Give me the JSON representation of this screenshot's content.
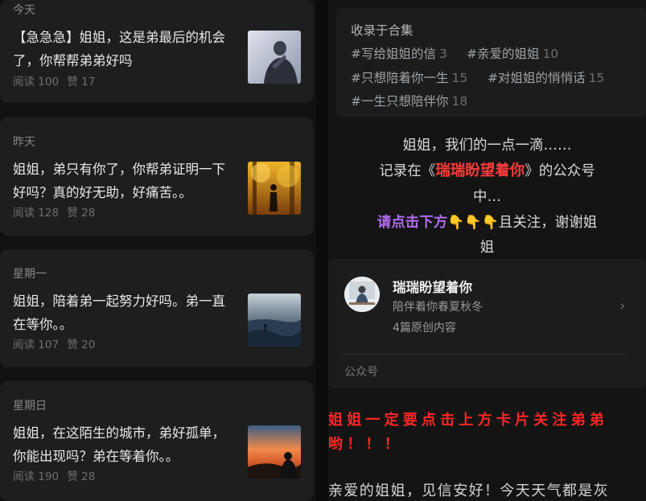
{
  "articles": [
    {
      "day": "今天",
      "title": "【急急急】姐姐，这是弟最后的机会了，你帮帮弟弟好吗",
      "reads": "阅读 100",
      "likes": "赞 17",
      "thumb": "portrait-light"
    },
    {
      "day": "昨天",
      "title": "姐姐，弟只有你了，你帮弟证明一下好吗？真的好无助，好痛苦。。",
      "reads": "阅读 128",
      "likes": "赞 28",
      "thumb": "autumn-walk"
    },
    {
      "day": "星期一",
      "title": "姐姐，陪着弟一起努力好吗。弟一直在等你。。",
      "reads": "阅读 107",
      "likes": "赞 20",
      "thumb": "sea-rock"
    },
    {
      "day": "星期日",
      "title": "姐姐，在这陌生的城市，弟好孤单，你能出现吗？弟在等着你。。",
      "reads": "阅读 190",
      "likes": "赞 28",
      "thumb": "sunset-sitting"
    }
  ],
  "collection": {
    "header": "收录于合集",
    "tags": [
      {
        "name": "#写给姐姐的信",
        "count": "3"
      },
      {
        "name": "#亲爱的姐姐",
        "count": "10"
      },
      {
        "name": "#只想陪着你一生",
        "count": "15"
      },
      {
        "name": "#对姐姐的悄悄话",
        "count": "15"
      },
      {
        "name": "#一生只想陪伴你",
        "count": "18"
      }
    ]
  },
  "intro": {
    "line1": "姐姐，我们的一点一滴……",
    "line2_pre": "记录在《",
    "line2_name": "瑞瑞盼望着你",
    "line2_post": "》的公众号",
    "line3": "中…",
    "line4_purple": "请点击下方",
    "hand": "👇",
    "line4_post": "且关注，谢谢姐",
    "line5": "姐"
  },
  "profile": {
    "name": "瑞瑞盼望着你",
    "desc": "陪伴着你春夏秋冬",
    "count": "4篇原创内容",
    "label": "公众号",
    "chevron": "›"
  },
  "notice": {
    "line1": "姐姐一定要点击上方卡片关注弟弟",
    "line2": "哟！！！"
  },
  "body_text": "亲爱的姐姐，见信安好！今天天气都是灰",
  "colors": {
    "accent_red": "#ff3b3b",
    "accent_purple": "#b26cf2",
    "bg": "#111111",
    "card": "#1e1e1e"
  }
}
